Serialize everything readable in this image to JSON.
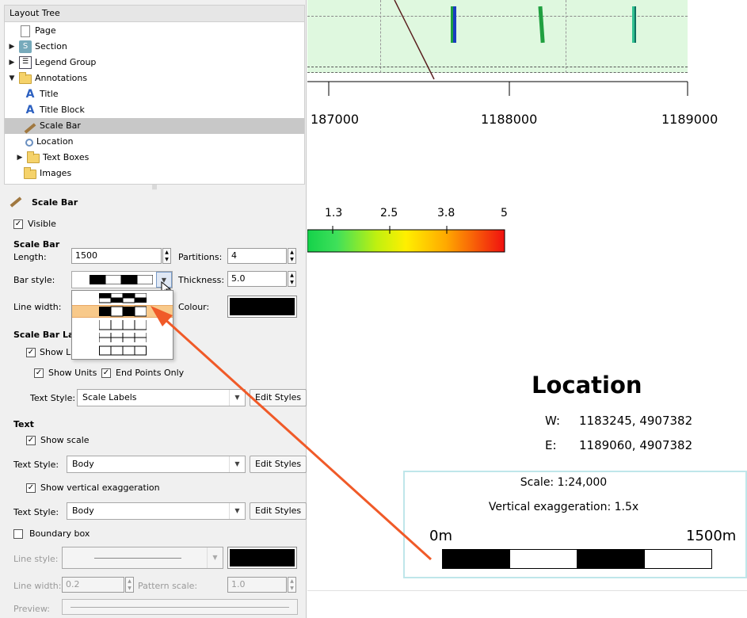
{
  "layout_tree": {
    "header": "Layout Tree",
    "items": [
      {
        "label": "Page",
        "icon": "page-icon"
      },
      {
        "label": "Section",
        "icon": "section-icon"
      },
      {
        "label": "Legend Group",
        "icon": "legend-icon"
      },
      {
        "label": "Annotations",
        "icon": "folder-icon"
      },
      {
        "label": "Title",
        "icon": "text-icon"
      },
      {
        "label": "Title Block",
        "icon": "text-icon"
      },
      {
        "label": "Scale Bar",
        "icon": "ruler-icon"
      },
      {
        "label": "Location",
        "icon": "magnifier-icon"
      },
      {
        "label": "Text Boxes",
        "icon": "folder-icon"
      },
      {
        "label": "Images",
        "icon": "folder-icon"
      }
    ]
  },
  "props": {
    "title": "Scale Bar",
    "visible_label": "Visible",
    "scale_bar_section": "Scale Bar",
    "length_label": "Length:",
    "length_value": "1500",
    "partitions_label": "Partitions:",
    "partitions_value": "4",
    "bar_style_label": "Bar style:",
    "thickness_label": "Thickness:",
    "thickness_value": "5.0",
    "line_width_label": "Line width:",
    "colour_label": "Colour:",
    "labels_section": "Scale Bar Labe",
    "show_labels": "Show La",
    "show_units": "Show Units",
    "end_points_only": "End Points Only",
    "text_style_label": "Text Style:",
    "scale_labels_value": "Scale Labels",
    "edit_styles": "Edit Styles",
    "text_section": "Text",
    "show_scale": "Show scale",
    "body_value": "Body",
    "show_vertical_exaggeration": "Show vertical exaggeration",
    "boundary_box": "Boundary box",
    "line_style_label": "Line style:",
    "line_width2_label": "Line width:",
    "line_width2_value": "0.2",
    "pattern_scale_label": "Pattern scale:",
    "pattern_scale_value": "1.0",
    "preview_label": "Preview:"
  },
  "axis": {
    "ticks": [
      "187000",
      "1188000",
      "1189000"
    ]
  },
  "colorbar": {
    "ticks": [
      "1.3",
      "2.5",
      "3.8",
      "5"
    ]
  },
  "location": {
    "title": "Location",
    "w_label": "W:",
    "w_value": "1183245, 4907382",
    "e_label": "E:",
    "e_value": "1189060, 4907382"
  },
  "scale_box": {
    "scale_text": "Scale: 1:24,000",
    "exaggeration_text": "Vertical exaggeration: 1.5x",
    "left_label": "0m",
    "right_label": "1500m"
  },
  "colors": {
    "accent": "#f05a28",
    "plot_fill": "#dff8df",
    "selection": "#f8c98a"
  }
}
